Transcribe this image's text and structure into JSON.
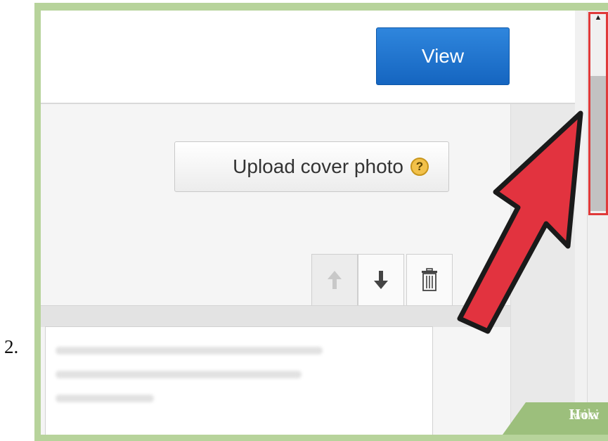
{
  "step": {
    "number": "2."
  },
  "toolbar": {
    "view_label": "View"
  },
  "cover": {
    "upload_label": "Upload cover photo",
    "help_symbol": "?"
  },
  "controls": [
    {
      "name": "move-up",
      "icon": "arrow-up-icon",
      "enabled": false
    },
    {
      "name": "move-down",
      "icon": "arrow-down-icon",
      "enabled": true
    },
    {
      "name": "delete",
      "icon": "trash-icon",
      "enabled": true
    }
  ],
  "scrollbar": {
    "up_arrow": "▲",
    "highlight_color": "#e03a3a"
  },
  "annotation": {
    "arrow_color": "#e2333f",
    "icon": "pointer-arrow-icon"
  },
  "watermark": {
    "part1": "wiki",
    "part2": "How"
  },
  "colors": {
    "accent": "#1a73d1",
    "frame": "#b7d39b"
  }
}
